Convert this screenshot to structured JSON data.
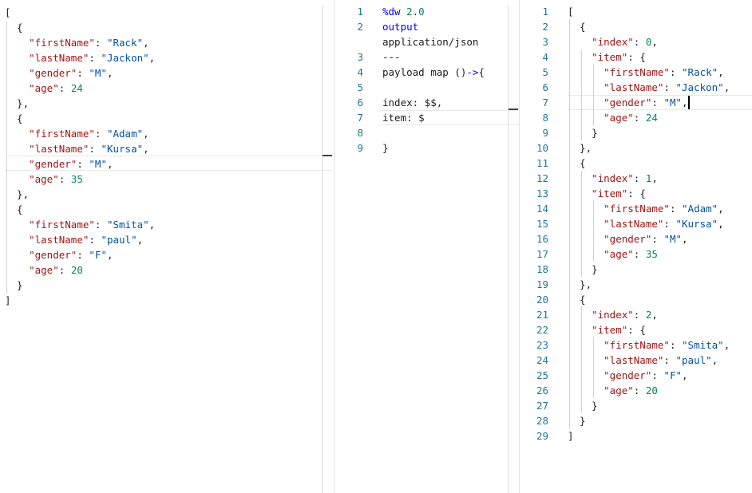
{
  "input_editor": {
    "lines": [
      "[",
      "  {",
      "    \"firstName\": \"Rack\",",
      "    \"lastName\": \"Jackon\",",
      "    \"gender\": \"M\",",
      "    \"age\": 24",
      "  },",
      "  {",
      "    \"firstName\": \"Adam\",",
      "    \"lastName\": \"Kursa\",",
      "    \"gender\": \"M\",",
      "    \"age\": 35",
      "  },",
      "  {",
      "    \"firstName\": \"Smita\",",
      "    \"lastName\": \"paul\",",
      "    \"gender\": \"F\",",
      "    \"age\": 20",
      "  }",
      "]"
    ]
  },
  "script_editor": {
    "lines": [
      {
        "num": "1",
        "text": "%dw 2.0"
      },
      {
        "num": "2",
        "text": "output"
      },
      {
        "num": "",
        "text": "application/json"
      },
      {
        "num": "3",
        "text": "---"
      },
      {
        "num": "4",
        "text": "payload map ()->{"
      },
      {
        "num": "5",
        "text": ""
      },
      {
        "num": "6",
        "text": "index: $$,"
      },
      {
        "num": "7",
        "text": "item: $"
      },
      {
        "num": "8",
        "text": ""
      },
      {
        "num": "9",
        "text": "}"
      }
    ]
  },
  "output_editor": {
    "lines": [
      {
        "num": "1",
        "text": "["
      },
      {
        "num": "2",
        "text": "  {"
      },
      {
        "num": "3",
        "text": "    \"index\": 0,"
      },
      {
        "num": "4",
        "text": "    \"item\": {"
      },
      {
        "num": "5",
        "text": "      \"firstName\": \"Rack\","
      },
      {
        "num": "6",
        "text": "      \"lastName\": \"Jackon\","
      },
      {
        "num": "7",
        "text": "      \"gender\": \"M\","
      },
      {
        "num": "8",
        "text": "      \"age\": 24"
      },
      {
        "num": "9",
        "text": "    }"
      },
      {
        "num": "10",
        "text": "  },"
      },
      {
        "num": "11",
        "text": "  {"
      },
      {
        "num": "12",
        "text": "    \"index\": 1,"
      },
      {
        "num": "13",
        "text": "    \"item\": {"
      },
      {
        "num": "14",
        "text": "      \"firstName\": \"Adam\","
      },
      {
        "num": "15",
        "text": "      \"lastName\": \"Kursa\","
      },
      {
        "num": "16",
        "text": "      \"gender\": \"M\","
      },
      {
        "num": "17",
        "text": "      \"age\": 35"
      },
      {
        "num": "18",
        "text": "    }"
      },
      {
        "num": "19",
        "text": "  },"
      },
      {
        "num": "20",
        "text": "  {"
      },
      {
        "num": "21",
        "text": "    \"index\": 2,"
      },
      {
        "num": "22",
        "text": "    \"item\": {"
      },
      {
        "num": "23",
        "text": "      \"firstName\": \"Smita\","
      },
      {
        "num": "24",
        "text": "      \"lastName\": \"paul\","
      },
      {
        "num": "25",
        "text": "      \"gender\": \"F\","
      },
      {
        "num": "26",
        "text": "      \"age\": 20"
      },
      {
        "num": "27",
        "text": "    }"
      },
      {
        "num": "28",
        "text": "  }"
      },
      {
        "num": "29",
        "text": "]"
      }
    ]
  },
  "colors": {
    "key": "#a31515",
    "string": "#0451a5",
    "number": "#098658",
    "keyword": "#0000ff",
    "line_number": "#237893"
  }
}
